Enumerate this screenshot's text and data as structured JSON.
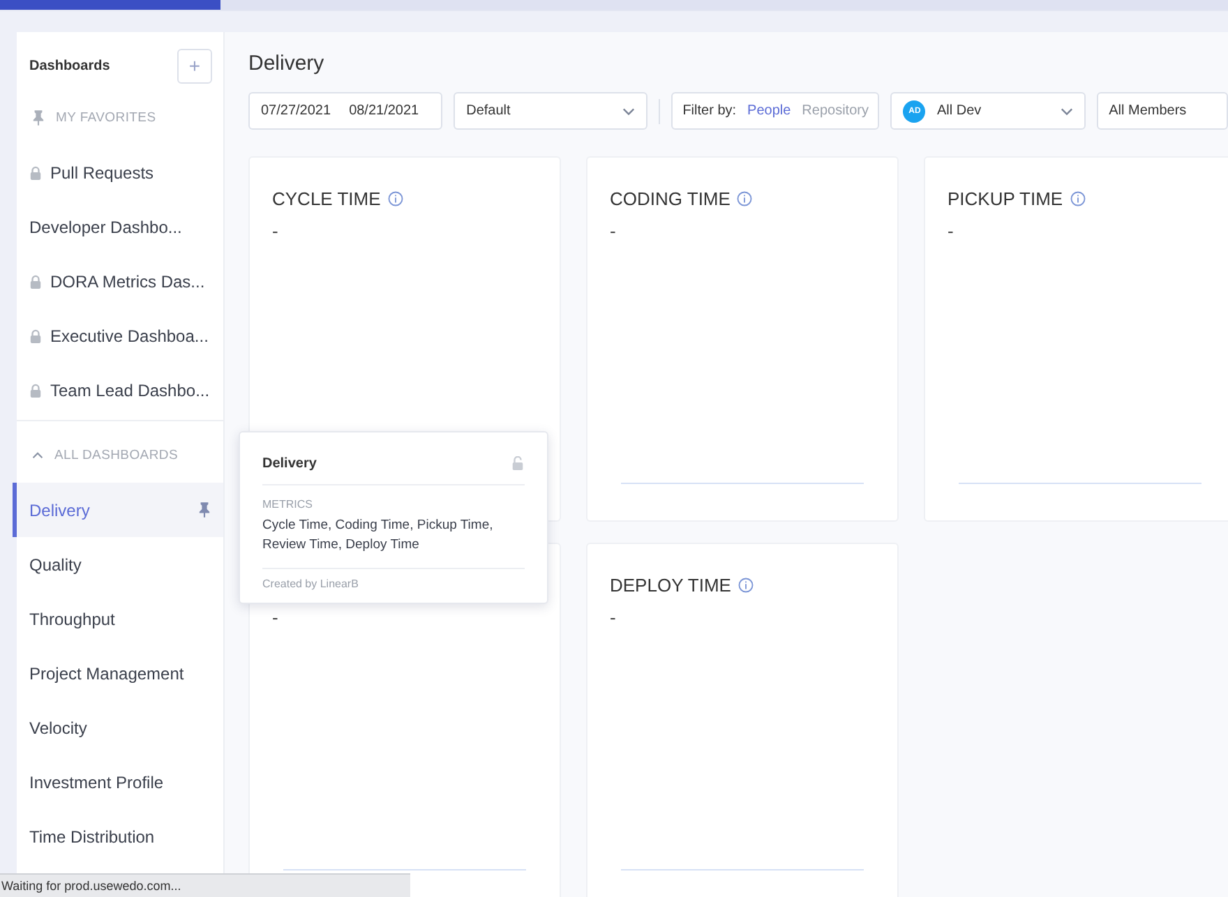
{
  "loading_bar": {
    "level": 0.18
  },
  "sidebar": {
    "title": "Dashboards",
    "add_label": "+",
    "favorites_heading": "MY FAVORITES",
    "favorites": [
      {
        "label": "Pull Requests",
        "locked": true
      },
      {
        "label": "Developer Dashbo...",
        "locked": false
      },
      {
        "label": "DORA Metrics Das...",
        "locked": true
      },
      {
        "label": "Executive Dashboa...",
        "locked": true
      },
      {
        "label": "Team Lead Dashbo...",
        "locked": true
      }
    ],
    "all_heading": "ALL DASHBOARDS",
    "all_expanded": true,
    "dashboards": [
      {
        "label": "Delivery",
        "selected": true
      },
      {
        "label": "Quality",
        "selected": false
      },
      {
        "label": "Throughput",
        "selected": false
      },
      {
        "label": "Project Management",
        "selected": false
      },
      {
        "label": "Velocity",
        "selected": false
      },
      {
        "label": "Investment Profile",
        "selected": false
      },
      {
        "label": "Time Distribution",
        "selected": false
      }
    ]
  },
  "page_title": "Delivery",
  "toolbar": {
    "date_from": "07/27/2021",
    "date_to": "08/21/2021",
    "preset": "Default",
    "filter_label": "Filter by:",
    "filter_options": [
      {
        "label": "People",
        "selected": true
      },
      {
        "label": "Repository",
        "selected": false
      }
    ],
    "team_avatar": "AD",
    "team": "All Dev",
    "members": "All Members"
  },
  "cards": [
    {
      "title": "CYCLE TIME",
      "value": "-"
    },
    {
      "title": "CODING TIME",
      "value": "-"
    },
    {
      "title": "PICKUP TIME",
      "value": "-"
    },
    {
      "value": "-"
    },
    {
      "title": "DEPLOY TIME",
      "value": "-"
    }
  ],
  "tooltip": {
    "title": "Delivery",
    "locked": false,
    "section": "METRICS",
    "metrics": "Cycle Time, Coding Time, Pickup Time, Review Time, Deploy Time",
    "footer": "Created by LinearB"
  },
  "status_bar": "Waiting for prod.usewedo.com..."
}
